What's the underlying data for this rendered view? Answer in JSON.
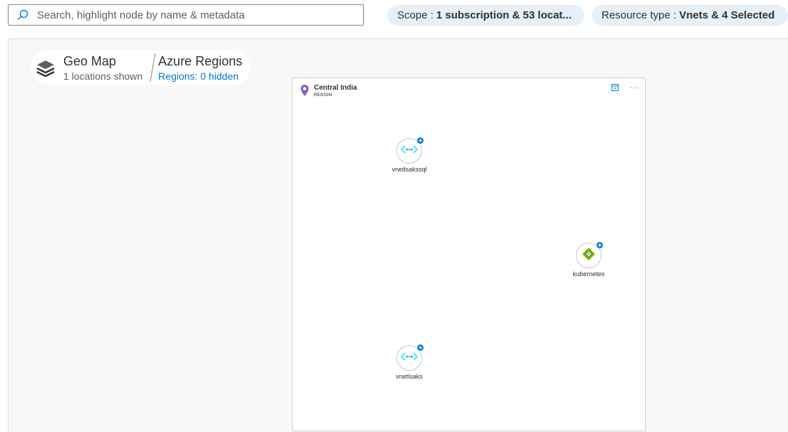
{
  "search": {
    "placeholder": "Search, highlight node by name & metadata",
    "value": ""
  },
  "filters": {
    "scope": {
      "label": "Scope :",
      "value": "1 subscription & 53 locat..."
    },
    "resource_type": {
      "label": "Resource type :",
      "value": "Vnets & 4 Selected"
    }
  },
  "breadcrumb": {
    "geo_map": {
      "title": "Geo Map",
      "subtitle": "1 locations shown"
    },
    "azure_regions": {
      "title": "Azure Regions",
      "link": "Regions: 0 hidden"
    }
  },
  "region": {
    "name": "Central India",
    "type": "REGION",
    "nodes": [
      {
        "label": "vnetlsakssql",
        "icon": "virtual-network-icon"
      },
      {
        "label": "kubernetes",
        "icon": "kubernetes-service-icon"
      },
      {
        "label": "vnetlsaks",
        "icon": "virtual-network-icon"
      }
    ]
  },
  "colors": {
    "accent": "#0078d4",
    "pill_bg": "#e6f0f9",
    "canvas_bg": "#f8f8f8",
    "pin": "#8661c5",
    "vnet": "#50e6ff",
    "kubernetes": "#5ea0ef"
  }
}
